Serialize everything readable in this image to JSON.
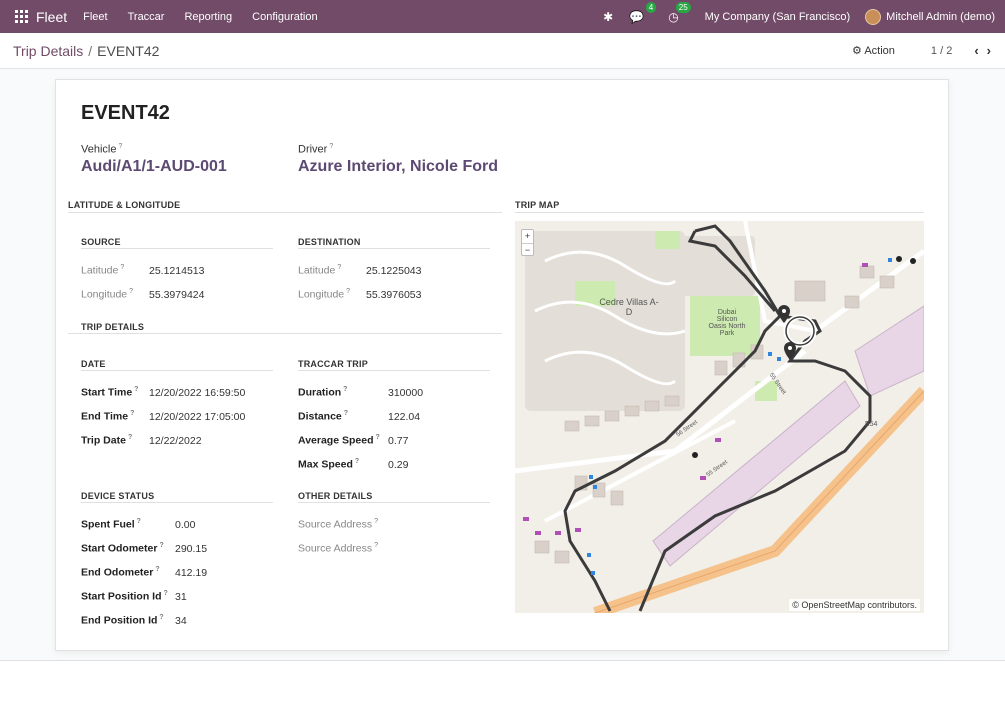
{
  "navbar": {
    "app_name": "Fleet",
    "menus": [
      "Fleet",
      "Traccar",
      "Reporting",
      "Configuration"
    ],
    "messages_count": "4",
    "activities_count": "25",
    "company": "My Company (San Francisco)",
    "user": "Mitchell Admin (demo)",
    "brand_color": "#714b67"
  },
  "control_panel": {
    "breadcrumb_parent": "Trip Details",
    "breadcrumb_separator": "/",
    "breadcrumb_current": "EVENT42",
    "action_label": "Action",
    "pager": "1 / 2"
  },
  "record": {
    "name": "EVENT42",
    "vehicle_label": "Vehicle",
    "vehicle": "Audi/A1/1-AUD-001",
    "driver_label": "Driver",
    "driver": "Azure Interior, Nicole Ford"
  },
  "sections": {
    "lat_long": "LATITUDE & LONGITUDE",
    "trip_map": "TRIP MAP",
    "source": "SOURCE",
    "destination": "DESTINATION",
    "trip_details": "TRIP DETAILS",
    "date": "DATE",
    "traccar_trip": "TRACCAR TRIP",
    "device_status": "DEVICE STATUS",
    "other_details": "OTHER DETAILS"
  },
  "source": {
    "lat_label": "Latitude",
    "lat": "25.1214513",
    "lon_label": "Longitude",
    "lon": "55.3979424"
  },
  "destination": {
    "lat_label": "Latitude",
    "lat": "25.1225043",
    "lon_label": "Longitude",
    "lon": "55.3976053"
  },
  "date": {
    "start_label": "Start Time",
    "start": "12/20/2022 16:59:50",
    "end_label": "End Time",
    "end": "12/20/2022 17:05:00",
    "trip_label": "Trip Date",
    "trip": "12/22/2022"
  },
  "traccar": {
    "duration_label": "Duration",
    "duration": "310000",
    "distance_label": "Distance",
    "distance": "122.04",
    "avg_label": "Average Speed",
    "avg": "0.77",
    "max_label": "Max Speed",
    "max": "0.29"
  },
  "device": {
    "fuel_label": "Spent Fuel",
    "fuel": "0.00",
    "start_odo_label": "Start Odometer",
    "start_odo": "290.15",
    "end_odo_label": "End Odometer",
    "end_odo": "412.19",
    "start_pos_label": "Start Position Id",
    "start_pos": "31",
    "end_pos_label": "End Position Id",
    "end_pos": "34"
  },
  "other": {
    "src_addr_label_1": "Source Address",
    "src_addr_label_2": "Source Address"
  },
  "map": {
    "zoom_in": "+",
    "zoom_out": "−",
    "attribution": "© OpenStreetMap contributors.",
    "label_cedre": "Cedre Villas A-D",
    "label_dso": "Dubai Silicon Oasis North Park",
    "label_e54": "E54",
    "label_street1": "55 Street",
    "label_street2": "56 Street",
    "label_street3": "55 Street"
  }
}
